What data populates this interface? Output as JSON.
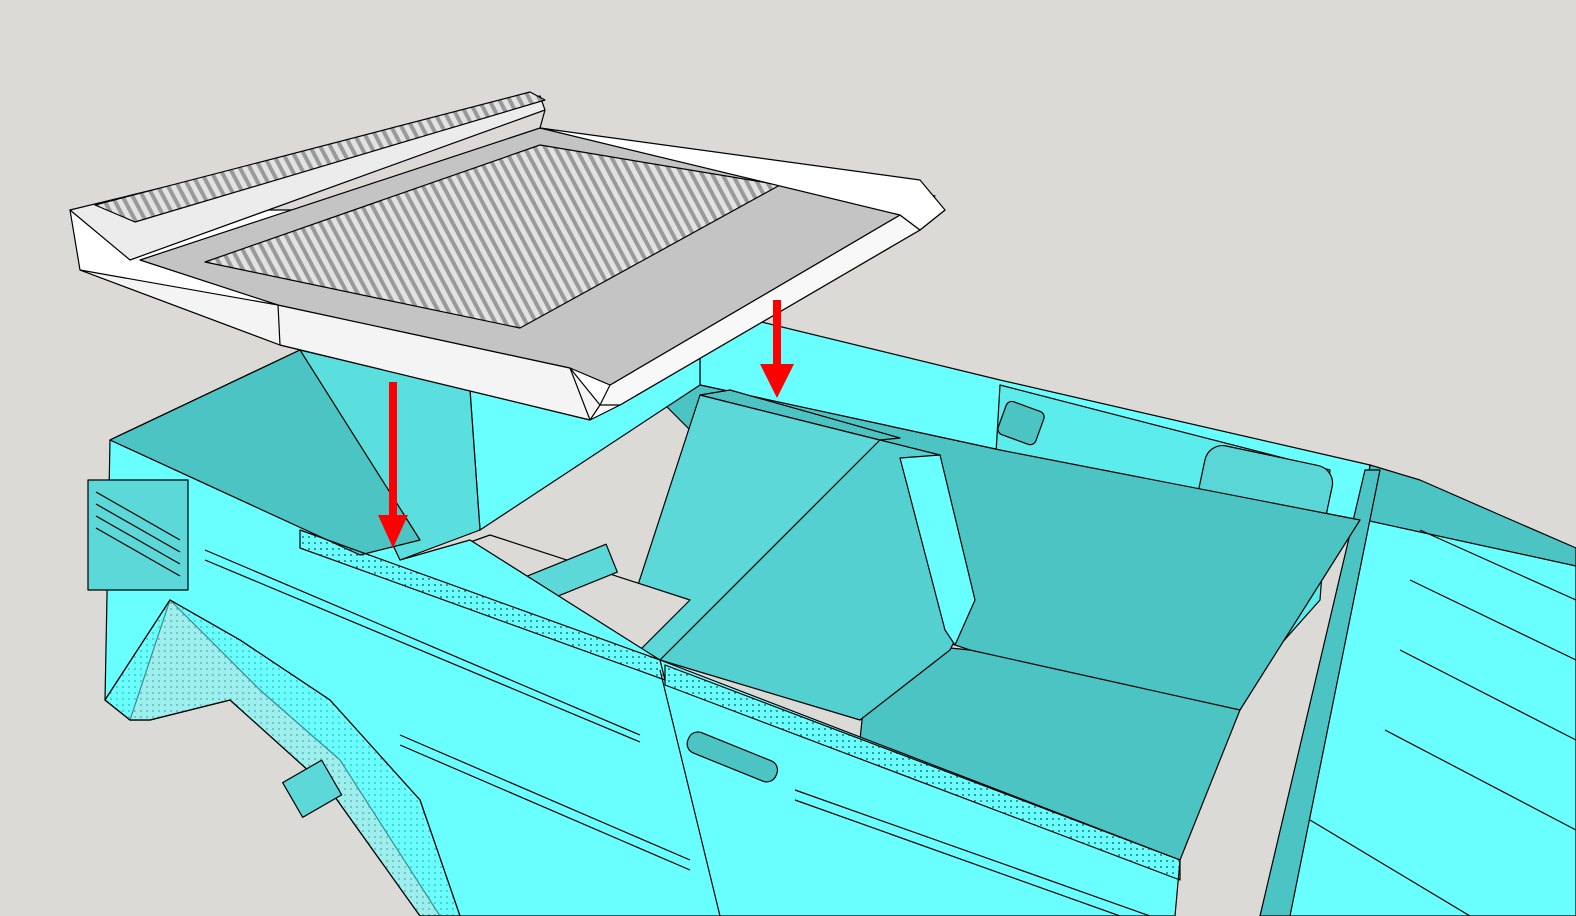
{
  "scene": {
    "kind": "3D model viewport",
    "background_color": "#dcdad6",
    "body_color": "#6affff",
    "body_shadow_color": "#4dc4c4",
    "panel_color": "#ffffff",
    "panel_shadow_color": "#c4c4c4",
    "arrow_color": "#ff0000",
    "annotations": [
      {
        "name": "arrow-left",
        "direction": "down"
      },
      {
        "name": "arrow-right",
        "direction": "down"
      }
    ]
  }
}
